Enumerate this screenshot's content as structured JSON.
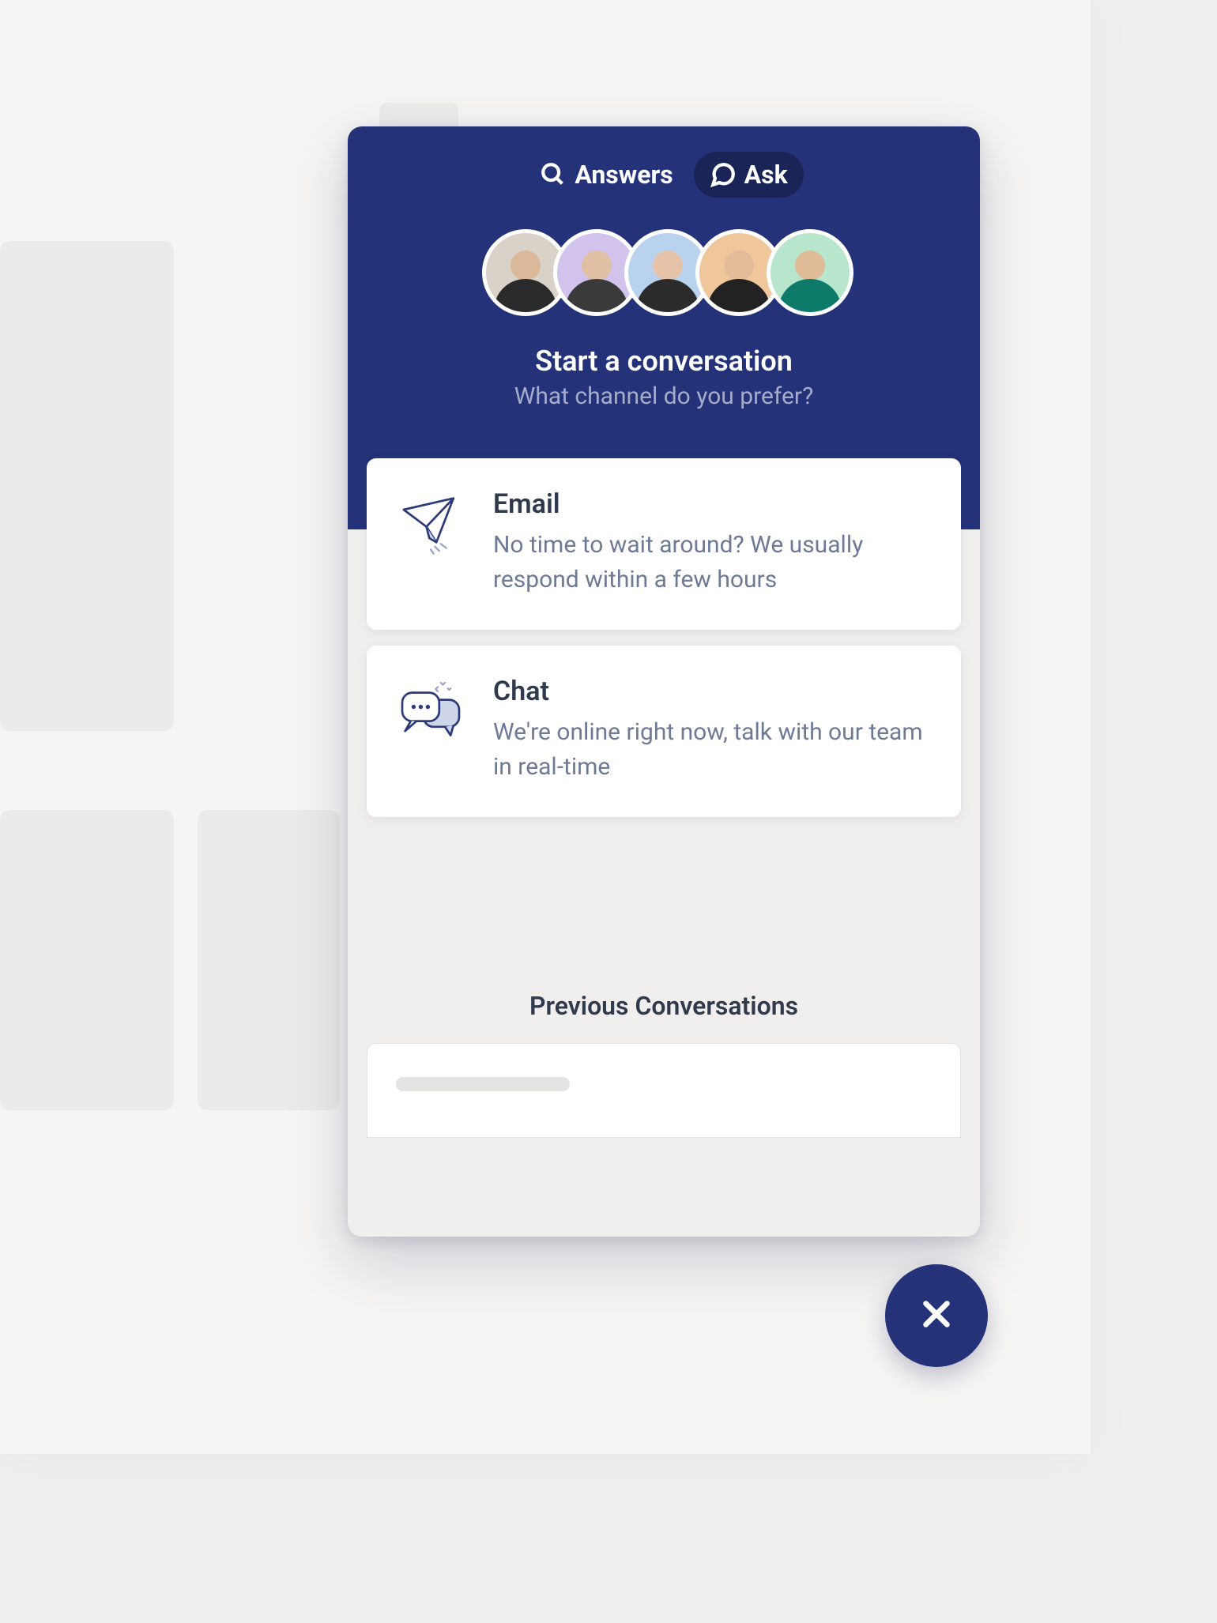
{
  "tabs": {
    "answers": "Answers",
    "ask": "Ask"
  },
  "header": {
    "title": "Start a conversation",
    "subtitle": "What channel do you prefer?"
  },
  "channels": {
    "email": {
      "title": "Email",
      "description": "No time to wait around? We usually respond within a few hours"
    },
    "chat": {
      "title": "Chat",
      "description": "We're online right now, talk with our team in real-time"
    }
  },
  "previous": {
    "title": "Previous Conversations"
  },
  "avatars": [
    {
      "bg": "#d9d2c8"
    },
    {
      "bg": "#d2c3ec"
    },
    {
      "bg": "#b9d3ef"
    },
    {
      "bg": "#f0c79b"
    },
    {
      "bg": "#b7e6cd"
    }
  ],
  "colors": {
    "brand": "#24327a",
    "brandDark": "#1a2456",
    "textPrimary": "#2f3b4c",
    "textSecondary": "#6d7a95",
    "headerSubtitle": "#a4acc9"
  }
}
